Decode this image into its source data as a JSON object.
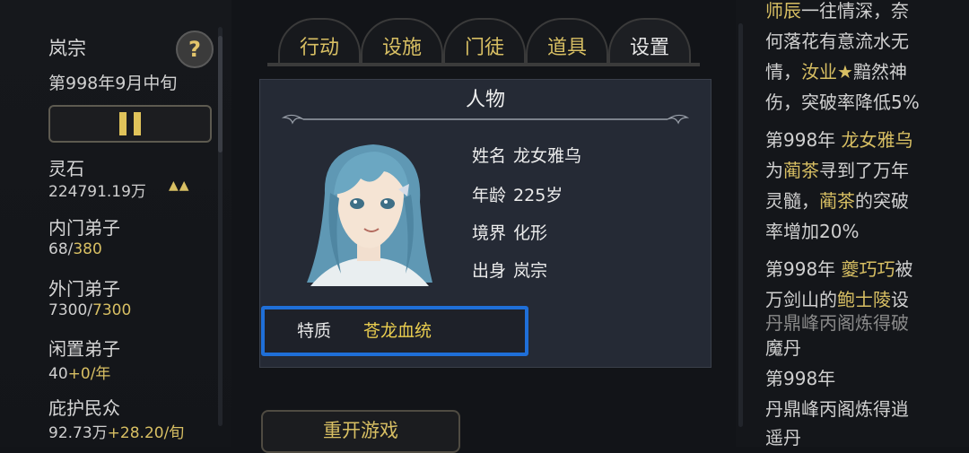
{
  "left": {
    "sect_name": "岚宗",
    "date": "第998年9月中旬",
    "help_label": "?",
    "stats": [
      {
        "label": "灵石",
        "value": "224791.19万",
        "trend": "▲▲"
      },
      {
        "label": "内门弟子",
        "value_main": "68/",
        "value_cap": "380"
      },
      {
        "label": "外门弟子",
        "value_main": "7300/",
        "value_cap": "7300"
      },
      {
        "label": "闲置弟子",
        "value_main": "40",
        "value_rate": "+0/年"
      },
      {
        "label": "庇护民众",
        "value_main": "92.73万",
        "value_rate": "+28.20/旬"
      }
    ]
  },
  "tabs": [
    "行动",
    "设施",
    "门徒",
    "道具",
    "设置"
  ],
  "restart_label": "重开游戏",
  "modal": {
    "title": "人物",
    "fields": [
      {
        "label": "姓名",
        "value": "龙女雅乌"
      },
      {
        "label": "年龄",
        "value": "225岁"
      },
      {
        "label": "境界",
        "value": "化形"
      },
      {
        "label": "出身",
        "value": "岚宗"
      }
    ],
    "trait_label": "特质",
    "trait_value": "苍龙血统"
  },
  "log": {
    "l1a": "师辰",
    "l1b": "一往情深，奈",
    "l2": "何落花有意流水无",
    "l3": "情，",
    "l3b": "汝业★",
    "l3c": "黯然神",
    "l4": "伤，突破率降低5%",
    "l5a": "第998年 ",
    "l5b": "龙女雅乌",
    "l6a": "为",
    "l6b": "蔺茶",
    "l6c": "寻到了万年",
    "l7": "灵髓，",
    "l7b": "蔺茶",
    "l7c": "的突破",
    "l8": "率增加20%",
    "l9a": "第998年 ",
    "l9b": "夔巧巧",
    "l9c": "被",
    "l10a": "万剑山的",
    "l10b": "鲍士陵",
    "l10c": "设",
    "l11": "丹鼎峰丙阁炼得破",
    "l12": "魔丹",
    "l13": "第998年",
    "l14": "丹鼎峰丙阁炼得逍",
    "l15": "遥丹"
  }
}
